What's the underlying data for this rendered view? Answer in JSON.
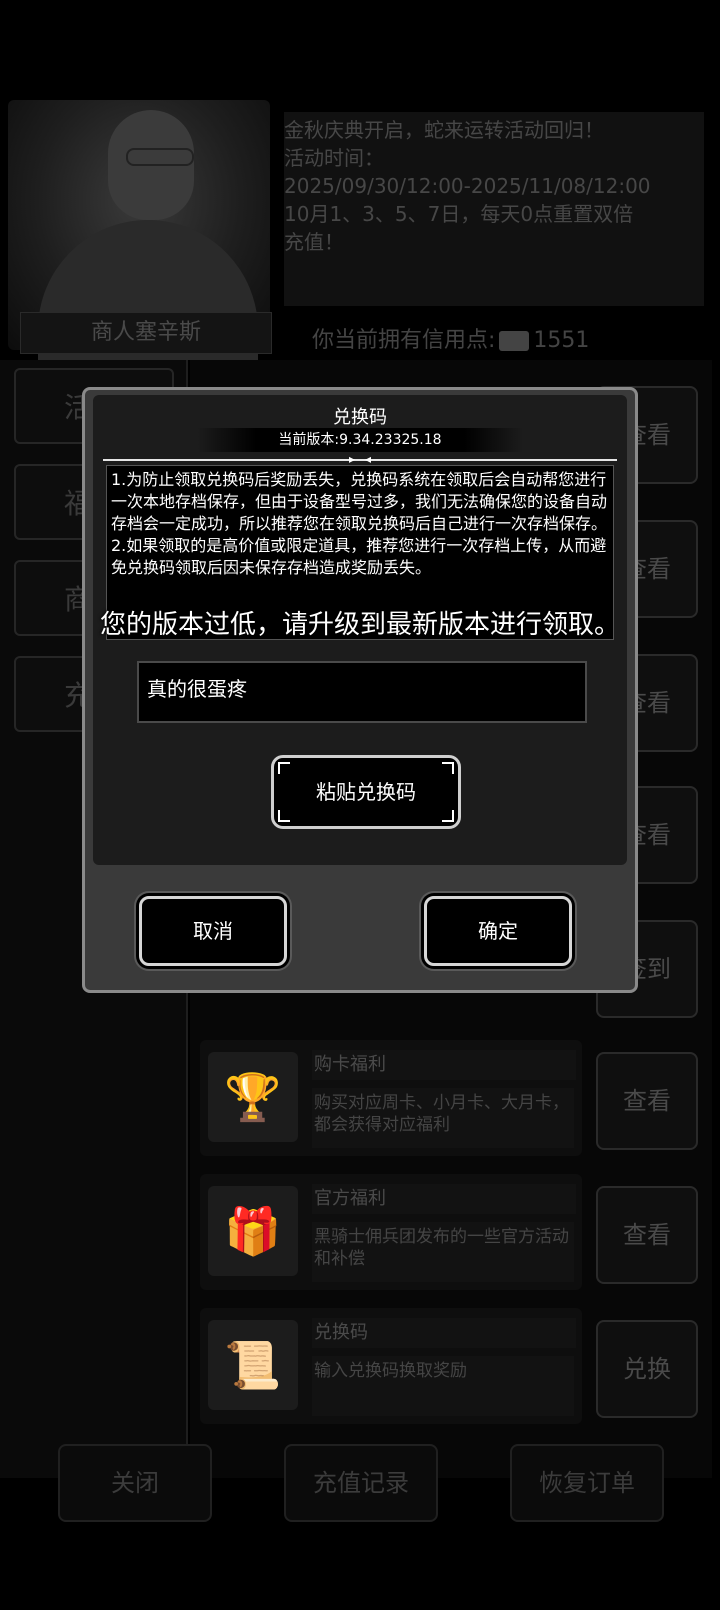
{
  "merchant": {
    "name": "商人塞辛斯"
  },
  "announcement": {
    "lines": [
      "金秋庆典开启，蛇来运转活动回归！",
      "活动时间：",
      "2025/09/30/12:00-2025/11/08/12:00",
      "10月1、3、5、7日，每天0点重置双倍",
      "充值！"
    ]
  },
  "credits": {
    "label": "你当前拥有信用点:",
    "value": "1551"
  },
  "left_tabs": [
    "活",
    "福",
    "商",
    "充"
  ],
  "rows": [
    {
      "button": "查看"
    },
    {
      "button": "查看"
    },
    {
      "button": "查看"
    },
    {
      "button": "查看"
    },
    {
      "button": "签到"
    },
    {
      "title": "购卡福利",
      "desc": "购买对应周卡、小月卡、大月卡，都会获得对应福利",
      "button": "查看",
      "icon": "trophy-card-icon"
    },
    {
      "title": "官方福利",
      "desc": "黑骑士佣兵团发布的一些官方活动和补偿",
      "button": "查看",
      "icon": "gift-box-icon"
    },
    {
      "title": "兑换码",
      "desc": "输入兑换码换取奖励",
      "button": "兑换",
      "icon": "scroll-icon"
    }
  ],
  "footer": {
    "close": "关闭",
    "recharge_history": "充值记录",
    "restore_order": "恢复订单"
  },
  "dialog": {
    "title": "兑换码",
    "version": "当前版本:9.34.23325.18",
    "notice_1": "1.为防止领取兑换码后奖励丢失，兑换码系统在领取后会自动帮您进行一次本地存档保存，但由于设备型号过多，我们无法确保您的设备自动存档会一定成功，所以推荐您在领取兑换码后自己进行一次存档保存。",
    "notice_2": "2.如果领取的是高价值或限定道具，推荐您进行一次存档上传，从而避免兑换码领取后因未保存存档造成奖励丢失。",
    "code_value": "真的很蛋疼",
    "paste_label": "粘贴兑换码",
    "cancel_label": "取消",
    "confirm_label": "确定"
  },
  "toast": "您的版本过低，请升级到最新版本进行领取。",
  "colors": {
    "overlay_background": "#000000",
    "dialog_frame": "#8a8a8a",
    "dialog_body": "#1c1c1c",
    "text": "#ffffff"
  }
}
